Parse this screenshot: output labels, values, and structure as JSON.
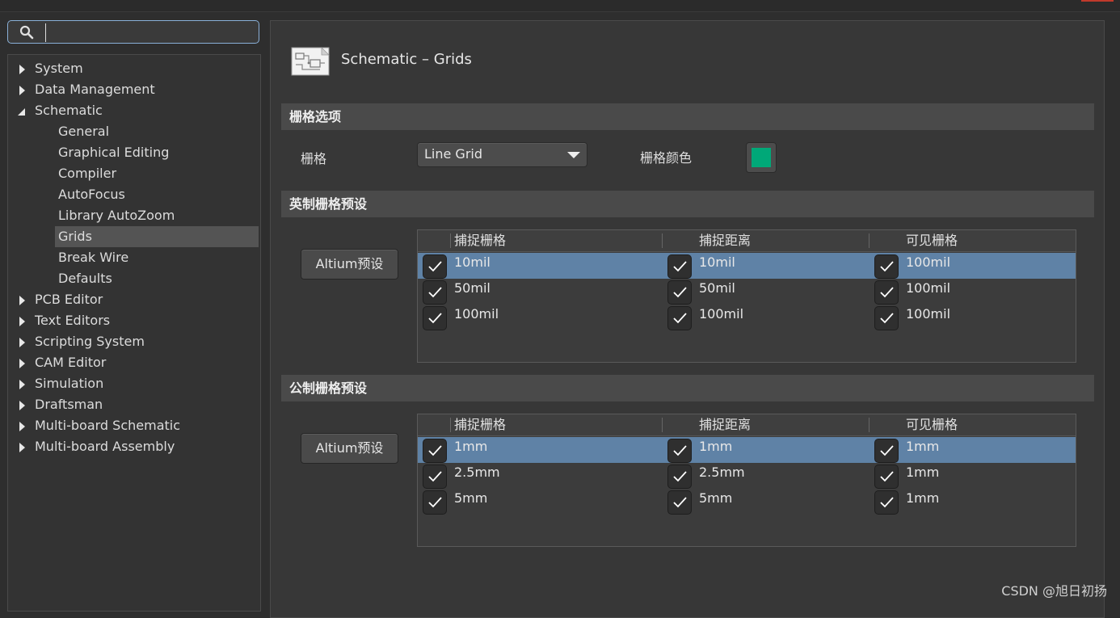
{
  "search": {
    "placeholder": "",
    "value": ""
  },
  "tree": [
    {
      "label": "System",
      "level": 0,
      "state": "collapsed"
    },
    {
      "label": "Data Management",
      "level": 0,
      "state": "collapsed"
    },
    {
      "label": "Schematic",
      "level": 0,
      "state": "expanded"
    },
    {
      "label": "General",
      "level": 1
    },
    {
      "label": "Graphical Editing",
      "level": 1
    },
    {
      "label": "Compiler",
      "level": 1
    },
    {
      "label": "AutoFocus",
      "level": 1
    },
    {
      "label": "Library AutoZoom",
      "level": 1
    },
    {
      "label": "Grids",
      "level": 1,
      "selected": true
    },
    {
      "label": "Break Wire",
      "level": 1
    },
    {
      "label": "Defaults",
      "level": 1
    },
    {
      "label": "PCB Editor",
      "level": 0,
      "state": "collapsed"
    },
    {
      "label": "Text Editors",
      "level": 0,
      "state": "collapsed"
    },
    {
      "label": "Scripting System",
      "level": 0,
      "state": "collapsed"
    },
    {
      "label": "CAM Editor",
      "level": 0,
      "state": "collapsed"
    },
    {
      "label": "Simulation",
      "level": 0,
      "state": "collapsed"
    },
    {
      "label": "Draftsman",
      "level": 0,
      "state": "collapsed"
    },
    {
      "label": "Multi-board Schematic",
      "level": 0,
      "state": "collapsed"
    },
    {
      "label": "Multi-board Assembly",
      "level": 0,
      "state": "collapsed"
    }
  ],
  "page": {
    "title": "Schematic – Grids"
  },
  "grid_options": {
    "header": "栅格选项",
    "grid_label": "栅格",
    "grid_value": "Line Grid",
    "color_label": "栅格颜色",
    "color": "#00a878"
  },
  "imperial": {
    "header": "英制栅格预设",
    "button": "Altium预设",
    "columns": [
      "捕捉栅格",
      "捕捉距离",
      "可见栅格"
    ],
    "rows": [
      {
        "snap": "10mil",
        "distance": "10mil",
        "visible": "100mil",
        "selected": true
      },
      {
        "snap": "50mil",
        "distance": "50mil",
        "visible": "100mil"
      },
      {
        "snap": "100mil",
        "distance": "100mil",
        "visible": "100mil"
      }
    ]
  },
  "metric": {
    "header": "公制栅格预设",
    "button": "Altium预设",
    "columns": [
      "捕捉栅格",
      "捕捉距离",
      "可见栅格"
    ],
    "rows": [
      {
        "snap": "1mm",
        "distance": "1mm",
        "visible": "1mm",
        "selected": true
      },
      {
        "snap": "2.5mm",
        "distance": "2.5mm",
        "visible": "1mm"
      },
      {
        "snap": "5mm",
        "distance": "5mm",
        "visible": "1mm"
      }
    ]
  },
  "watermark": "CSDN @旭日初扬"
}
